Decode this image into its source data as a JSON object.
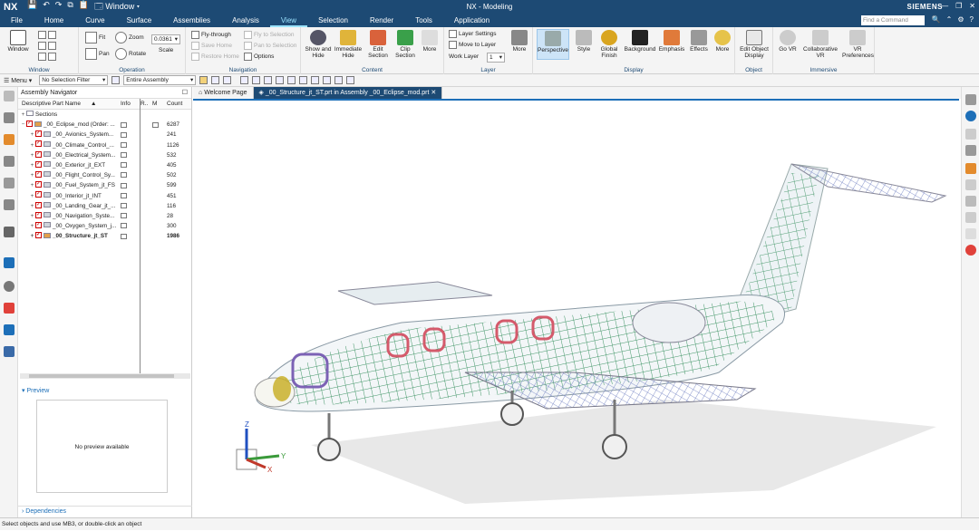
{
  "app": {
    "logo": "NX",
    "window_menu": "Window",
    "title": "NX - Modeling",
    "brand": "SIEMENS"
  },
  "menu": {
    "tabs": [
      "File",
      "Home",
      "Curve",
      "Surface",
      "Assemblies",
      "Analysis",
      "View",
      "Selection",
      "Render",
      "Tools",
      "Application"
    ],
    "active": "View",
    "find_placeholder": "Find a Command"
  },
  "ribbon": {
    "window": {
      "button": "Window",
      "group": "Window"
    },
    "operation": {
      "fit": "Fit",
      "zoom": "Zoom",
      "pan": "Pan",
      "rotate": "Rotate",
      "scale_value": "0.0361",
      "scale": "Scale",
      "group": "Operation"
    },
    "navigation": {
      "fly_through": "Fly-through",
      "fly_to_selection": "Fly to Selection",
      "save_home": "Save Home",
      "pan_to_selection": "Pan to Selection",
      "restore_home": "Restore Home",
      "options": "Options",
      "group": "Navigation"
    },
    "content": {
      "show_hide": "Show and Hide",
      "immediate_hide": "Immediate Hide",
      "edit_section": "Edit Section",
      "clip_section": "Clip Section",
      "more": "More",
      "group": "Content"
    },
    "layer": {
      "layer_settings": "Layer Settings",
      "move_to_layer": "Move to Layer",
      "work_layer": "Work Layer",
      "work_layer_value": "1",
      "more": "More",
      "group": "Layer"
    },
    "display": {
      "perspective": "Perspective",
      "style": "Style",
      "global_finish": "Global Finish",
      "background": "Background",
      "emphasis": "Emphasis",
      "effects": "Effects",
      "more": "More",
      "group": "Display"
    },
    "object": {
      "edit_object_display": "Edit Object Display",
      "group": "Object"
    },
    "immersive": {
      "go_vr": "Go VR",
      "collaborative_vr": "Collaborative VR",
      "vr_preferences": "VR Preferences",
      "group": "Immersive"
    }
  },
  "commandbar": {
    "menu": "Menu",
    "selection_filter": "No Selection Filter",
    "scope": "Entire Assembly"
  },
  "navigator": {
    "title": "Assembly Navigator",
    "columns": [
      "Descriptive Part Name",
      "Info",
      "R..",
      "M",
      "Count"
    ],
    "rows": [
      {
        "name": "Sections",
        "count": "",
        "level": 0,
        "type": "folder"
      },
      {
        "name": "_00_Eclipse_mod (Order: ...",
        "count": "6287",
        "level": 0,
        "type": "root"
      },
      {
        "name": "_00_Avionics_System...",
        "count": "241",
        "level": 1
      },
      {
        "name": "_00_Climate_Control_...",
        "count": "1126",
        "level": 1
      },
      {
        "name": "_00_Electrical_System...",
        "count": "532",
        "level": 1
      },
      {
        "name": "_00_Exterior_jt_EXT",
        "count": "405",
        "level": 1
      },
      {
        "name": "_00_Flight_Control_Sy...",
        "count": "502",
        "level": 1
      },
      {
        "name": "_00_Fuel_System_jt_FS",
        "count": "599",
        "level": 1
      },
      {
        "name": "_00_Interior_jt_INT",
        "count": "451",
        "level": 1
      },
      {
        "name": "_00_Landing_Gear_jt_...",
        "count": "116",
        "level": 1
      },
      {
        "name": "_00_Navigation_Syste...",
        "count": "28",
        "level": 1
      },
      {
        "name": "_00_Oxygen_System_j...",
        "count": "300",
        "level": 1
      },
      {
        "name": "_00_Structure_jt_ST",
        "count": "1986",
        "level": 1,
        "bold": true
      }
    ],
    "preview_label": "Preview",
    "no_preview": "No preview available",
    "dependencies_label": "Dependencies"
  },
  "doc_tabs": [
    "Welcome Page",
    "_00_Structure_jt_ST.prt in Assembly _00_Eclipse_mod.prt"
  ],
  "triad": {
    "z": "Z",
    "y": "Y",
    "x": "X"
  },
  "status": "Select objects and use MB3, or double-click an object",
  "colors": {
    "title_bg": "#1d4a74",
    "accent": "#1d6fb8",
    "active_tab": "#9be3ff"
  }
}
